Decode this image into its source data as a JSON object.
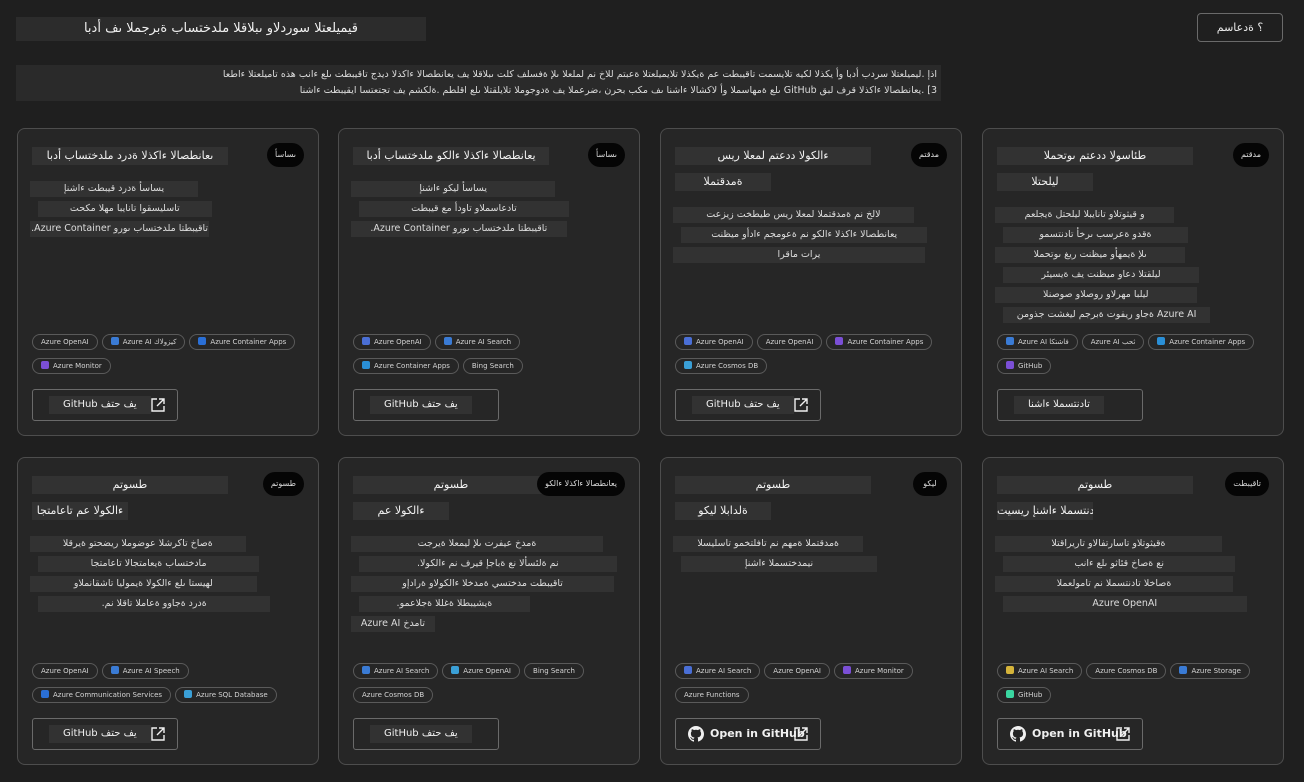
{
  "header": {
    "title": "قيميلعتلا سوردلاو ىبلاقلا ملدختساب ةبرجملا ىف أدبا",
    "help_label": "؟ ةدعاسم"
  },
  "intro": {
    "line1": "اذإ .ليميلعتلا سردب أدبا وأ يكذلا لكيه تلايسمت تاقيبطت عم ةيكذلا تلايميلعتلا ةعبتم للاخ نم لملعلا ىلإ ةفسلف كلت ىبلاقلا يف يعانطصالا ءاكذلا ديدج تاقيبطت ىلع ءانب هذه تاميلعتلا ءاطعا",
    "line2": "3] .يعانطصالا ءاكذلا قرف لبق GitHub ىلع ةمهاسملا وأ لاكشالا ءاشنا ىف مكب بحرن ،ضرعملا يف ةدوجوملا تلايلقتلا ىلع اقلطم .ةلكشم يف تجتعتسا ايقيبطت ءاشنا"
  },
  "colors": {
    "background": "#1f1f1f",
    "card": "#262626",
    "border": "#4d4d4d",
    "text_block": "#323232"
  },
  "cards": [
    {
      "title": "ىعانطصالا ءاكذلا ةدرد ملدختساب أدبا",
      "title2": "",
      "badge": "ىساسأ",
      "desc": [
        "يساسأ ةدرد قيبطت ءاشنإ",
        "تاسليسقوا تانايبا مهلا مكحت",
        "تاقيبطتا ملدختساب ىورو Azure Container."
      ],
      "tags": [
        {
          "label": "Azure OpenAI",
          "color": ""
        },
        {
          "label": "Azure AI كيزولاك",
          "color": "#3a7bd5"
        },
        {
          "label": "Azure Container Apps",
          "color": "#2a6fd6"
        },
        {
          "label": "Azure Monitor",
          "color": "#7b4fd6"
        }
      ],
      "button": {
        "label": "GitHub يف حتف",
        "full": false
      }
    },
    {
      "title": "يعانطصالا ءاكذلا ءالكو ملدختساب أدبا",
      "title2": "",
      "badge": "ىساسأ",
      "desc": [
        "يساسأ ليكو ءاشنإ",
        "تادعاسملاو تاودأ مع قيبطت",
        "تاقيبطتا ملدختساب ىورو Azure Container."
      ],
      "tags": [
        {
          "label": "Azure OpenAI",
          "color": "#4a6fd6"
        },
        {
          "label": "Azure AI Search",
          "color": "#3a7bd5"
        },
        {
          "label": "Azure Container Apps",
          "color": "#2a8fd6"
        },
        {
          "label": "Bing Search",
          "color": ""
        }
      ],
      "button": {
        "label": "GitHub يف حتف",
        "full": false
      }
    },
    {
      "title": "ءالكولا ددعتم لمعلا ريس",
      "title2": "ةمدقتملا",
      "badge": "مدقتم",
      "desc": [
        "لالخ نم ةمدقتملا لمعلا ريس طيطخت زيزعت",
        "يعانطصالا ءاكذلا ءالكو نم ةعومجم ءادأو ميظنت",
        "يرات ماقرا"
      ],
      "tags": [
        {
          "label": "Azure OpenAI",
          "color": "#4a6fd6"
        },
        {
          "label": "Azure OpenAI",
          "color": ""
        },
        {
          "label": "Azure Container Apps",
          "color": "#7b4fd6"
        },
        {
          "label": "Azure Cosmos DB",
          "color": "#3a9fd6"
        }
      ],
      "button": {
        "label": "GitHub يف حتف",
        "full": false
      }
    },
    {
      "title": "طئاسولا ددعتم ىوتحملا",
      "title2": "ليلحتلا",
      "badge": "مدقتم",
      "desc": [
        "و قيثوتلاو تانايبلا ليلحتل ةيجلعم",
        "ةقدو ةعرسب ىرخأ تادنتسمو",
        "ىلإ ةيمهأو ميظنت ريغ ىوتحملا",
        "ليلقتلا دعاو ميظنت يف ةيسيئر",
        "ليلبا مهرلاو روصلاو صوصنلا",
        "Azure AI ةجاو ريفوت ةبرجم ليغشت جذومن"
      ],
      "tags": [
        {
          "label": "Azure AI فاشتكا",
          "color": "#3a7bd5"
        },
        {
          "label": "Azure AI ثحب",
          "color": ""
        },
        {
          "label": "Azure Container Apps",
          "color": "#2a8fd6"
        },
        {
          "label": "GitHub",
          "color": "#7b4fd6"
        }
      ],
      "button": {
        "label": "تادنتسملا ءاشنا",
        "full": false
      }
    },
    {
      "title": "طسوتم",
      "title2": "ءالكولا عم تاعامتجا",
      "badge": "طسوتم",
      "desc": [
        "ةصاخ تاكرشلا عوضوملا ريضحتو ةيرقلا",
        "مادختساب ةيعامتجالا تاعامتجا",
        "لهيستا ىلع ءالكولا ةيموليا تاشقانملاو",
        "ةدرد ةجاوو ةعاملا تاقلا نم."
      ],
      "tags": [
        {
          "label": "Azure OpenAI",
          "color": ""
        },
        {
          "label": "Azure AI Speech",
          "color": "#3a7bd5"
        },
        {
          "label": "Azure Communication Services",
          "color": "#2a6fd6"
        },
        {
          "label": "Azure SQL Database",
          "color": "#3a9fd6"
        }
      ],
      "button": {
        "label": "GitHub يف حتف",
        "full": false
      }
    },
    {
      "title": "طسوتم",
      "title2": "ءالكولا عم",
      "badge": "يعانطصالا ءاكذلا ءالكو",
      "desc": [
        "ةمدخ عيفرت ىلإ ليمعلا ةيرجت",
        "نم ةلئسألا نع ةباجإ قيرف نم ءالكولا.",
        "تاقيبطت مدختسي ةمدخلا ءالكولاو ةرادإو",
        "ةيشيبطلا ةغللا ةجلاعمو."
      ],
      "tags": [
        {
          "label": "Azure AI Search",
          "color": "#3a7bd5"
        },
        {
          "label": "Azure OpenAI",
          "color": "#3a9fd6"
        },
        {
          "label": "Bing Search",
          "color": ""
        },
        {
          "label": "Azure Cosmos DB",
          "color": ""
        }
      ],
      "extra": "Azure AI تامدخ",
      "button": {
        "label": "GitHub يف حتف",
        "full": false
      }
    },
    {
      "title": "طسوتم",
      "title2": "ةلدابلا ليكو",
      "badge": "ليكو",
      "desc": [
        "ةمدقتملا ةمهم نم تافلتخمو تاسليسلا",
        "نيمدختسملا ءاشنإ"
      ],
      "tags": [
        {
          "label": "Azure AI Search",
          "color": "#4a6fd6"
        },
        {
          "label": "Azure OpenAI",
          "color": ""
        },
        {
          "label": "Azure Monitor",
          "color": "#7b4fd6"
        },
        {
          "label": "Azure Functions",
          "color": ""
        }
      ],
      "button": {
        "label": "Open in GitHub",
        "full": true
      }
    },
    {
      "title": "طسوتم",
      "title2": "تادنتسملا ءاشنإ ريسيت",
      "badge": "تاقيبطت",
      "desc": [
        "ةقيثوتلاو تاسارتفالاو تاريراقتلا",
        "نع ةصاخ قئاثو ىلع ءانب",
        "ةصاخلا تادنتسملا نم تامولعملا",
        "Azure OpenAI"
      ],
      "tags": [
        {
          "label": "Azure AI Search",
          "color": "#d6b43a"
        },
        {
          "label": "Azure Cosmos DB",
          "color": ""
        },
        {
          "label": "Azure Storage",
          "color": "#3a7bd5"
        },
        {
          "label": "GitHub",
          "color": "#3ad6a0"
        }
      ],
      "button": {
        "label": "Open in GitHub",
        "full": true
      }
    }
  ]
}
